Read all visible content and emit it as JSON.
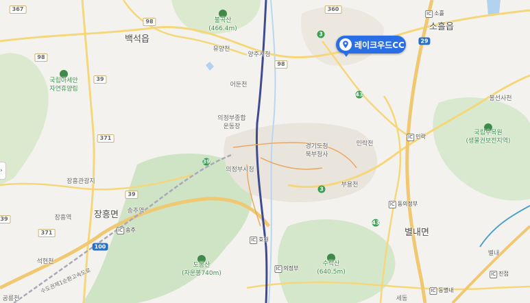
{
  "colors": {
    "land": "#f3f2ee",
    "forest": "#cfe3c5",
    "road_major": "#f5d77a",
    "highway": "#f0c872",
    "urban": "#eae5dc",
    "rail": "#3f4a8f",
    "water": "#b3d2ef",
    "pin": "#2a6ee6"
  },
  "pin": {
    "label": "레이크우드CC",
    "icon": "location-pin-icon"
  },
  "edge_button": {
    "glyph": "›"
  },
  "places": {
    "baekseok": "백석읍",
    "soheul": "소흘읍",
    "janghung": "장흥면",
    "byeollae": "별내면",
    "yangju_si": "양주시청",
    "eodun": "어둔천",
    "yuyang": "유양천",
    "uijeongbu_sports": "의정부종합\n운동장",
    "uijeongbu_city": "의정부시청",
    "gyeonggi_north": "경기도청\n북부청사",
    "minrak": "민락천",
    "buyong": "부용천",
    "jangheung_gwanggwang": "장흥관광지",
    "songchu": "송추역",
    "baekseok_right": "봉선사천",
    "gongneung": "공릉천",
    "seokhyeon": "석현천",
    "jangheung_mark": "장흥역",
    "arboretum": "국립수목원\n(생물권보전지역)",
    "recreation_forest": "국립아세안\n자연휴양림",
    "bulgoksan": "불곡산\n(466.4m)",
    "dobongsan": "도봉산\n(자운봉740m)",
    "surak": "수락산\n(640.5m)",
    "byeolnae_label": "별내",
    "sepyeong": "세동"
  },
  "ic": {
    "soheul": "소흘",
    "minrak": "민락",
    "dongeuijeongbu": "동의정부",
    "songchu": "송추",
    "howon": "호원",
    "uijeongbu": "의정부",
    "dongbyeollae": "동별내",
    "jinjeop": "진접"
  },
  "routes": {
    "r367": "367",
    "r360": "360",
    "r98a": "98",
    "r98b": "98",
    "r98c": "98",
    "r3a": "3",
    "r3b": "3",
    "r39a": "39",
    "r39b": "39",
    "r39c": "39",
    "r371a": "371",
    "r371b": "371",
    "r43a": "43",
    "r43b": "43",
    "r29": "29",
    "r100": "100",
    "e39": "39"
  },
  "road_name": "수도권제1순환고속도로"
}
